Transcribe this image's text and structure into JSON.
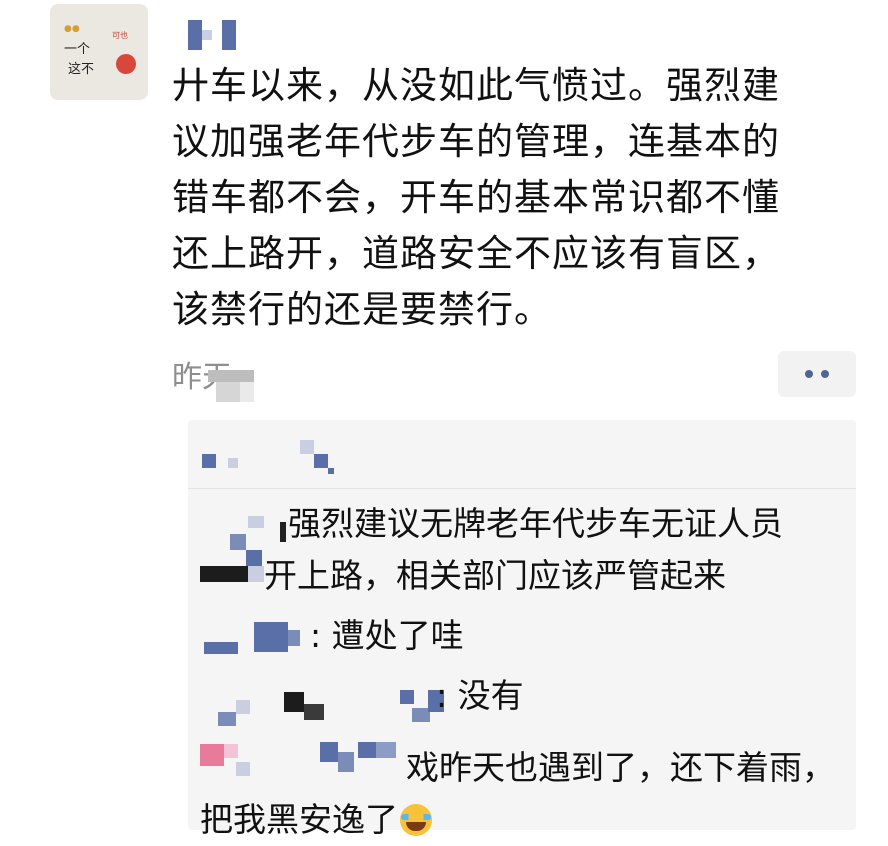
{
  "post": {
    "lines": [
      "廾车以来，从没如此气愤过。强烈建",
      "议加强老年代步车的管理，连基本的",
      "错车都不会，开车的基本常识都不懂",
      "还上路开，道路安全不应该有盲区，",
      "该禁行的还是要禁行。"
    ],
    "timestamp": "昨天"
  },
  "avatar": {
    "line1": "一个",
    "line2": "这不",
    "dots": "●●",
    "tag": "可也"
  },
  "comments": [
    {
      "text_line1": "强烈建议无牌老年代步车无证人员",
      "text_line2": "开上路，相关部门应该严管起来"
    },
    {
      "text": ": 遭处了哇"
    },
    {
      "text": ": 没有"
    },
    {
      "text_line1": "戏昨天也遇到了，还下着雨，",
      "text_line2": "把我黑安逸了",
      "emoji": "laughing-crying-emoji"
    }
  ],
  "colors": {
    "timestamp": "#8e8e8e",
    "more_dots": "#4f6590",
    "comment_bg": "#f5f5f5",
    "redaction_blue": "#5a6fa8"
  }
}
